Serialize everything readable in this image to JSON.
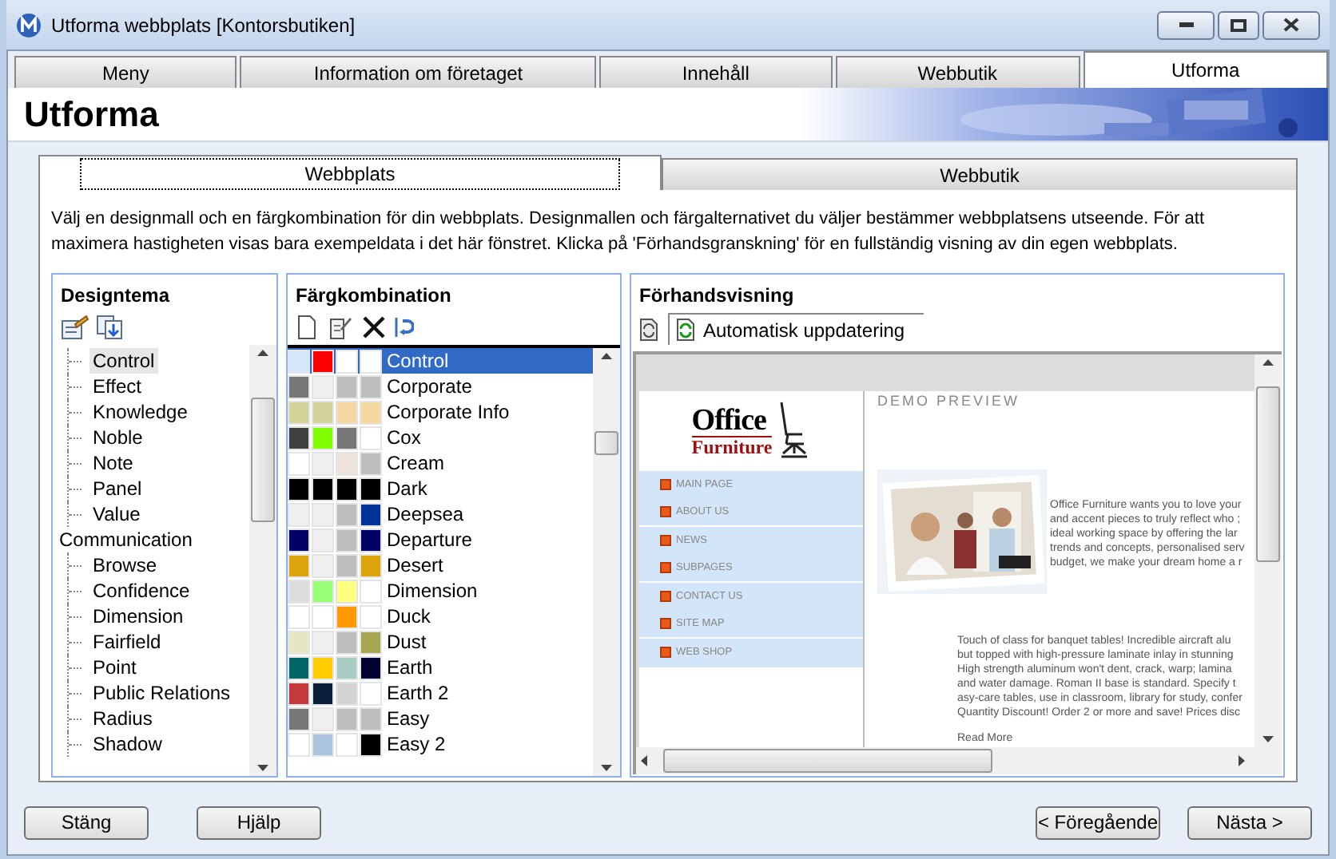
{
  "window": {
    "title": "Utforma webbplats [Kontorsbutiken]"
  },
  "tabs": [
    {
      "label": "Meny",
      "selected": false
    },
    {
      "label": "Information om företaget",
      "selected": false
    },
    {
      "label": "Innehåll",
      "selected": false
    },
    {
      "label": "Webbutik",
      "selected": false
    },
    {
      "label": "Utforma",
      "selected": true
    }
  ],
  "header": {
    "title": "Utforma"
  },
  "subtabs": [
    {
      "label": "Webbplats",
      "selected": true
    },
    {
      "label": "Webbutik",
      "selected": false
    }
  ],
  "description": "Välj en designmall och en färgkombination för din webbplats. Designmallen och färgalternativet du väljer bestämmer webbplatsens utseende. För att maximera hastigheten visas bara exempeldata i det här fönstret. Klicka på 'Förhandsgranskning' för en fullständig visning av din egen webbplats.",
  "design_theme": {
    "title": "Designtema",
    "tree": [
      {
        "children": [
          {
            "label": "Control",
            "selected": true
          },
          {
            "label": "Effect",
            "selected": false
          },
          {
            "label": "Knowledge",
            "selected": false
          },
          {
            "label": "Noble",
            "selected": false
          },
          {
            "label": "Note",
            "selected": false
          },
          {
            "label": "Panel",
            "selected": false
          },
          {
            "label": "Value",
            "selected": false
          }
        ]
      },
      {
        "label": "Communication",
        "selected": false,
        "children": [
          {
            "label": "Browse",
            "selected": false
          },
          {
            "label": "Confidence",
            "selected": false
          },
          {
            "label": "Dimension",
            "selected": false
          },
          {
            "label": "Fairfield",
            "selected": false
          },
          {
            "label": "Point",
            "selected": false
          },
          {
            "label": "Public Relations",
            "selected": false
          },
          {
            "label": "Radius",
            "selected": false
          },
          {
            "label": "Shadow",
            "selected": false
          }
        ]
      }
    ]
  },
  "color_schemes": {
    "title": "Färgkombination",
    "items": [
      {
        "name": "Control",
        "selected": true,
        "swatches": [
          {
            "color": "#d4e6fa"
          },
          {
            "color": "#ff0000"
          },
          {
            "color": "#ffffff"
          },
          {
            "color": "#ffffff"
          }
        ]
      },
      {
        "name": "Corporate",
        "selected": false,
        "swatches": [
          {
            "color": "#777777"
          },
          {
            "color": "#efefef"
          },
          {
            "color": "#bdbdbd"
          },
          {
            "color": "#bdbdbd"
          }
        ]
      },
      {
        "name": "Corporate Info",
        "selected": false,
        "swatches": [
          {
            "color": "#d4d49a"
          },
          {
            "color": "#d4d49a"
          },
          {
            "color": "#f6d9a0"
          },
          {
            "color": "#f6d9a0"
          }
        ]
      },
      {
        "name": "Cox",
        "selected": false,
        "swatches": [
          {
            "color": "#404040"
          },
          {
            "color": "#80ff00"
          },
          {
            "color": "#777777"
          },
          {
            "color": "#ffffff"
          }
        ]
      },
      {
        "name": "Cream",
        "selected": false,
        "swatches": [
          {
            "color": "#ffffff"
          },
          {
            "color": "#efefef"
          },
          {
            "color": "#efe4dd"
          },
          {
            "color": "#bdbdbd"
          }
        ]
      },
      {
        "name": "Dark",
        "selected": false,
        "swatches": [
          {
            "color": "#000000"
          },
          {
            "color": "#000000"
          },
          {
            "color": "#000000"
          },
          {
            "color": "#000000"
          }
        ]
      },
      {
        "name": "Deepsea",
        "selected": false,
        "swatches": [
          {
            "color": "#efefef"
          },
          {
            "color": "#efefef"
          },
          {
            "color": "#bdbdbd"
          },
          {
            "color": "#003399"
          }
        ]
      },
      {
        "name": "Departure",
        "selected": false,
        "swatches": [
          {
            "color": "#000066"
          },
          {
            "color": "#efefef"
          },
          {
            "color": "#bdbdbd"
          },
          {
            "color": "#000066"
          }
        ]
      },
      {
        "name": "Desert",
        "selected": false,
        "swatches": [
          {
            "color": "#dda30a"
          },
          {
            "color": "#efefef"
          },
          {
            "color": "#bdbdbd"
          },
          {
            "color": "#dda30a"
          }
        ]
      },
      {
        "name": "Dimension",
        "selected": false,
        "swatches": [
          {
            "color": "#dcdcdc"
          },
          {
            "color": "#99ff77"
          },
          {
            "color": "#ffff80"
          },
          {
            "color": "#ffffff"
          }
        ]
      },
      {
        "name": "Duck",
        "selected": false,
        "swatches": [
          {
            "color": "#ffffff"
          },
          {
            "color": "#ffffff"
          },
          {
            "color": "#ff9900"
          },
          {
            "color": "#ffffff"
          }
        ]
      },
      {
        "name": "Dust",
        "selected": false,
        "swatches": [
          {
            "color": "#e6e6c4"
          },
          {
            "color": "#efefef"
          },
          {
            "color": "#bdbdbd"
          },
          {
            "color": "#a5a552"
          }
        ]
      },
      {
        "name": "Earth",
        "selected": false,
        "swatches": [
          {
            "color": "#006666"
          },
          {
            "color": "#ffcc00"
          },
          {
            "color": "#a8cdc4"
          },
          {
            "color": "#000033"
          }
        ]
      },
      {
        "name": "Earth 2",
        "selected": false,
        "swatches": [
          {
            "color": "#c43a3a"
          },
          {
            "color": "#0c1f3a"
          },
          {
            "color": "#d4d4d4"
          },
          {
            "color": "#ffffff"
          }
        ]
      },
      {
        "name": "Easy",
        "selected": false,
        "swatches": [
          {
            "color": "#777777"
          },
          {
            "color": "#efefef"
          },
          {
            "color": "#bdbdbd"
          },
          {
            "color": "#bdbdbd"
          }
        ]
      },
      {
        "name": "Easy 2",
        "selected": false,
        "swatches": [
          {
            "color": "#ffffff"
          },
          {
            "color": "#acc4de"
          },
          {
            "color": "#ffffff"
          },
          {
            "color": "#000000"
          }
        ]
      }
    ]
  },
  "preview": {
    "title": "Förhandsvisning",
    "auto_update": {
      "label": "Automatisk uppdatering",
      "on": true
    },
    "site": {
      "logo_top": "Office",
      "logo_bottom": "Furniture",
      "nav": [
        "MAIN PAGE",
        "ABOUT US",
        "NEWS",
        "SUBPAGES",
        "CONTACT US",
        "SITE MAP",
        "WEB SHOP"
      ],
      "heading": "DEMO PREVIEW",
      "intro": [
        "Office Furniture wants you to love your",
        "and accent pieces to truly reflect who ;",
        "ideal working space by offering the lar",
        "trends and concepts, personalised serv",
        "budget, we make your dream home a r"
      ],
      "body": [
        "Touch of class for banquet tables! Incredible aircraft alu",
        "but topped with high-pressure laminate inlay in stunning",
        "High strength aluminum won't dent, crack, warp; lamina",
        "and water damage. Roman II base is standard. Specify t",
        "asy-care tables, use in classroom, library for study, confer",
        "Quantity Discount! Order 2 or more and save! Prices disc"
      ],
      "read_more": "Read More"
    }
  },
  "buttons_left": [
    {
      "label": "Stäng"
    },
    {
      "label": "Hjälp"
    }
  ],
  "buttons_right": [
    {
      "label": "< Föregående"
    },
    {
      "label": "Nästa >"
    }
  ]
}
